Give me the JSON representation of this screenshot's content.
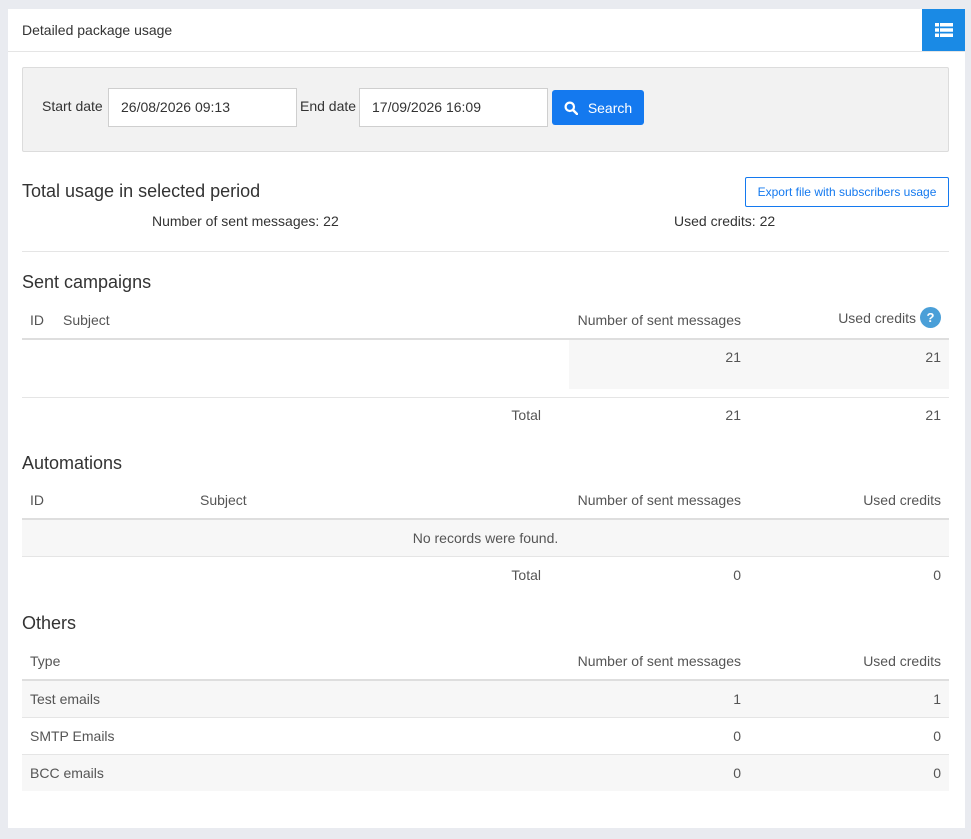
{
  "header": {
    "title": "Detailed package usage",
    "menu_icon": "list-icon"
  },
  "search": {
    "start_label": "Start date",
    "start_value": "26/08/2026 09:13",
    "end_label": "End date",
    "end_value": "17/09/2026 16:09",
    "button_label": "Search"
  },
  "total": {
    "title": "Total usage in selected period",
    "export_label": "Export file with subscribers usage",
    "sent_text": "Number of sent messages: 22",
    "credits_text": "Used credits: 22"
  },
  "campaigns": {
    "title": "Sent campaigns",
    "headers": {
      "id": "ID",
      "subject": "Subject",
      "sent": "Number of sent messages",
      "credits": "Used credits"
    },
    "rows": [
      {
        "id": "",
        "subject": "",
        "sent": "21",
        "credits": "21"
      }
    ],
    "total": {
      "label": "Total",
      "sent": "21",
      "credits": "21"
    }
  },
  "automations": {
    "title": "Automations",
    "headers": {
      "id": "ID",
      "subject": "Subject",
      "sent": "Number of sent messages",
      "credits": "Used credits"
    },
    "empty_text": "No records were found.",
    "total": {
      "label": "Total",
      "sent": "0",
      "credits": "0"
    }
  },
  "others": {
    "title": "Others",
    "headers": {
      "type": "Type",
      "sent": "Number of sent messages",
      "credits": "Used credits"
    },
    "rows": [
      {
        "type": "Test emails",
        "sent": "1",
        "credits": "1"
      },
      {
        "type": "SMTP Emails",
        "sent": "0",
        "credits": "0"
      },
      {
        "type": "BCC emails",
        "sent": "0",
        "credits": "0"
      }
    ]
  },
  "colors": {
    "primary": "#1479ef",
    "header_button": "#1a8ae5",
    "help_icon": "#4a9fd8"
  }
}
